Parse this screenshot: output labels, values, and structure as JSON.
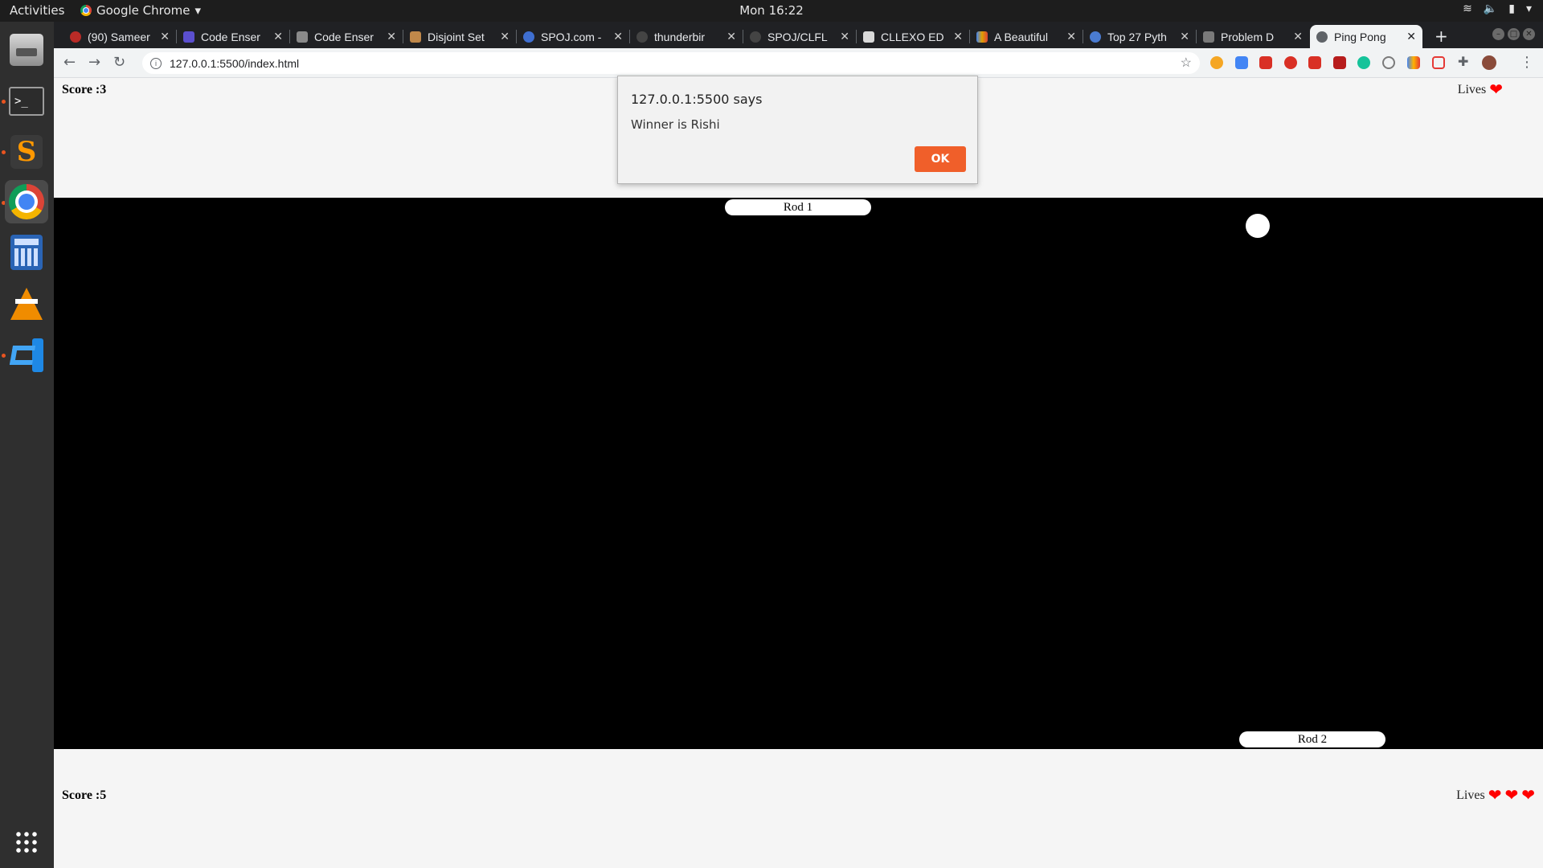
{
  "topbar": {
    "activities": "Activities",
    "app_name": "Google Chrome",
    "clock": "Mon 16:22",
    "system_icons": [
      "wifi-icon",
      "volume-icon",
      "battery-icon",
      "chevron-down-icon"
    ]
  },
  "dock": {
    "items": [
      {
        "name": "files",
        "icon": "files-icon"
      },
      {
        "name": "terminal",
        "icon": "terminal-icon",
        "running": true
      },
      {
        "name": "sublime-text",
        "icon": "sublime-icon",
        "running": true
      },
      {
        "name": "chrome",
        "icon": "chrome-icon",
        "running": true,
        "active": true
      },
      {
        "name": "calculator",
        "icon": "calculator-icon"
      },
      {
        "name": "vlc",
        "icon": "vlc-icon"
      },
      {
        "name": "vscode",
        "icon": "vscode-icon",
        "running": true
      }
    ],
    "show_apps_icon": "app-grid-icon"
  },
  "browser": {
    "tabs": [
      {
        "title": "(90) Sameer",
        "fav_color": "#b92b27"
      },
      {
        "title": "Code Enser",
        "fav_color": "#5b4fcf"
      },
      {
        "title": "Code Enser",
        "fav_color": "#8a8a8a"
      },
      {
        "title": "Disjoint Set",
        "fav_color": "#c0884a"
      },
      {
        "title": "SPOJ.com -",
        "fav_color": "#3f6fd1"
      },
      {
        "title": "thunderbir",
        "fav_color": "#444444"
      },
      {
        "title": "SPOJ/CLFL",
        "fav_color": "#444444"
      },
      {
        "title": "CLLEXO ED",
        "fav_color": "#d9d9d9"
      },
      {
        "title": "A Beautiful",
        "fav_color": "#e0a000"
      },
      {
        "title": "Top 27 Pyth",
        "fav_color": "#4a7bd0"
      },
      {
        "title": "Problem D",
        "fav_color": "#7a7a7a"
      },
      {
        "title": "Ping Pong",
        "fav_color": "#5f6368",
        "active": true
      }
    ],
    "url": "127.0.0.1:5500/index.html",
    "extension_colors": [
      "#f5a623",
      "#4285f4",
      "#d93025",
      "#d93025",
      "#d93025",
      "#b71c1c",
      "#15c39a",
      "#7a7a7a",
      "#ffb300",
      "#e53935",
      "#5f6368"
    ]
  },
  "game": {
    "top_score_label": "Score :3",
    "top_lives_label": "Lives",
    "top_lives": 1,
    "bottom_score_label": "Score :5",
    "bottom_lives_label": "Lives",
    "bottom_lives": 3,
    "rod1_label": "Rod 1",
    "rod2_label": "Rod 2",
    "arena_color": "#000000"
  },
  "dialog": {
    "origin": "127.0.0.1:5500 says",
    "message": "Winner is Rishi",
    "ok_label": "OK",
    "ok_color": "#f05f2a"
  }
}
